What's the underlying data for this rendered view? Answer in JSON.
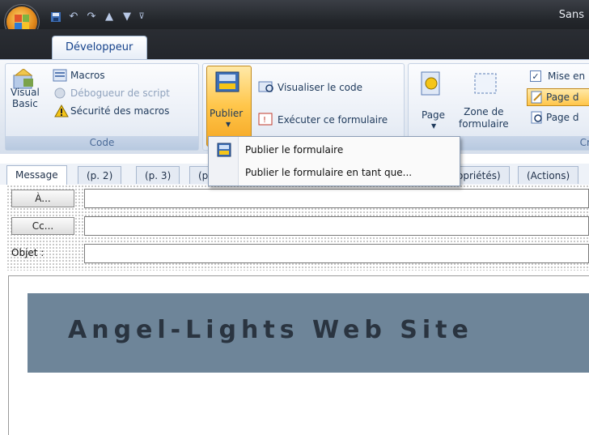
{
  "window": {
    "title": "Sans"
  },
  "tabs": {
    "developer": "Développeur"
  },
  "ribbon": {
    "code_group": {
      "label": "Code",
      "visual_basic": "Visual\nBasic",
      "macros": "Macros",
      "debugger": "Débogueur de script",
      "macro_security": "Sécurité des macros"
    },
    "form_group": {
      "publish": "Publier",
      "view_code": "Visualiser le code",
      "run_form": "Exécuter ce formulaire"
    },
    "design_group": {
      "label": "Cré",
      "page": "Page",
      "form_region": "Zone de\nformulaire",
      "layout": "Mise en",
      "page_d1": "Page d",
      "page_d2": "Page d"
    }
  },
  "publish_menu": {
    "items": [
      {
        "label": "Publier le formulaire"
      },
      {
        "label": "Publier le formulaire en tant que..."
      }
    ]
  },
  "form_tabs": [
    {
      "label": "Message"
    },
    {
      "label": "(p. 2)"
    },
    {
      "label": "(p. 3)"
    },
    {
      "label": "(p"
    },
    {
      "label": "opriétés)"
    },
    {
      "label": "(Actions)"
    }
  ],
  "fields": {
    "to_button": "À...",
    "cc_button": "Cc...",
    "subject_label": "Objet :"
  },
  "banner": {
    "text": "Angel-Lights Web Site"
  }
}
